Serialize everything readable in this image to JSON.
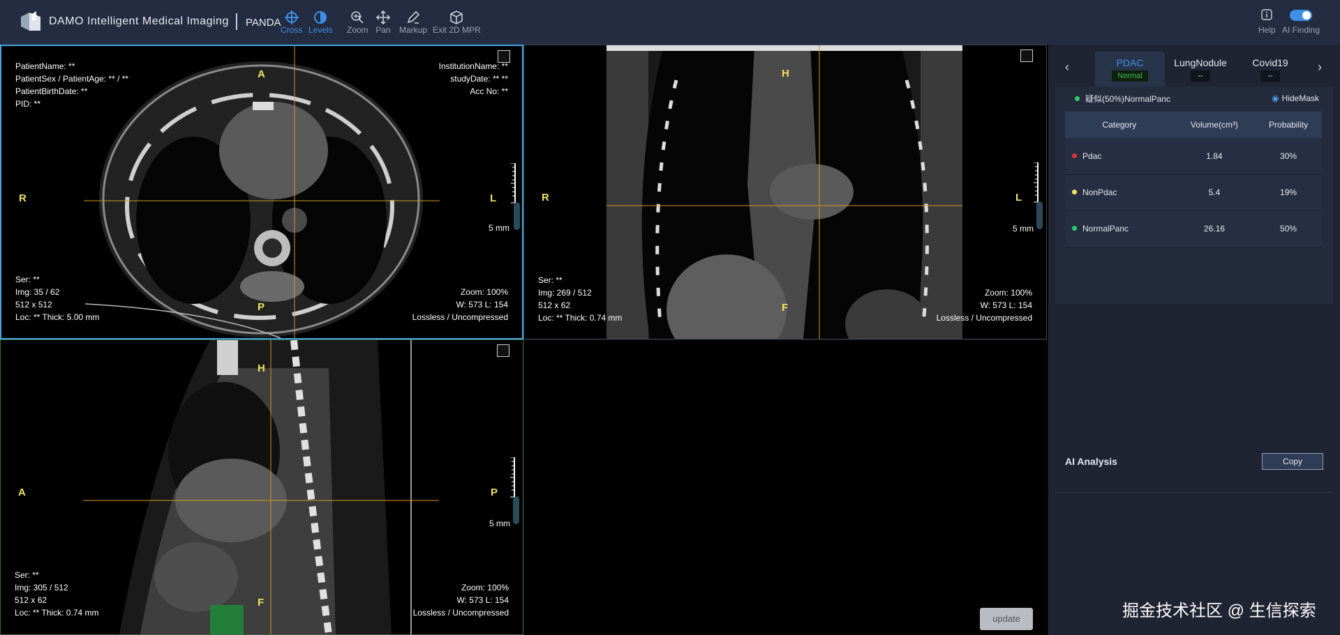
{
  "brand": {
    "name": "DAMO Intelligent Medical Imaging",
    "separator": "|",
    "sub": "PANDA"
  },
  "toolbar": [
    {
      "label": "Cross",
      "icon": "crosshair-icon",
      "active": true
    },
    {
      "label": "Levels",
      "icon": "levels-icon",
      "active": true
    },
    {
      "label": "Zoom",
      "icon": "zoom-icon",
      "active": false
    },
    {
      "label": "Pan",
      "icon": "pan-icon",
      "active": false
    },
    {
      "label": "Markup",
      "icon": "markup-icon",
      "active": false
    },
    {
      "label": "Exit 2D MPR",
      "icon": "cube-icon",
      "active": false
    }
  ],
  "toolbar_right": {
    "help": "Help",
    "ai_finding": "AI Finding"
  },
  "viewports": {
    "axial": {
      "patient": [
        "PatientName: **",
        "PatientSex / PatientAge: ** / **",
        "PatientBirthDate: **",
        "PID: **"
      ],
      "institution": [
        "InstitutionName: **",
        "studyDate: ** **",
        "Acc No: **"
      ],
      "series": [
        "Ser: **",
        "Img: 35 / 62",
        "512 x 512",
        "Loc: ** Thick: 5.00 mm"
      ],
      "display": [
        "Zoom: 100%",
        "W: 573 L: 154",
        "Lossless / Uncompressed"
      ],
      "orient": {
        "top": "A",
        "bottom": "P",
        "left": "R",
        "right": "L"
      },
      "scale": "5 mm"
    },
    "coronal": {
      "series": [
        "Ser: **",
        "Img: 269 / 512",
        "512 x 62",
        "Loc: ** Thick: 0.74 mm"
      ],
      "display": [
        "Zoom: 100%",
        "W: 573 L: 154",
        "Lossless / Uncompressed"
      ],
      "orient": {
        "top": "H",
        "bottom": "F",
        "left": "R",
        "right": "L"
      },
      "scale": "5 mm"
    },
    "sagittal": {
      "series": [
        "Ser: **",
        "Img: 305 / 512",
        "512 x 62",
        "Loc: ** Thick: 0.74 mm"
      ],
      "display": [
        "Zoom: 100%",
        "W: 573 L: 154",
        "Lossless / Uncompressed"
      ],
      "orient": {
        "top": "H",
        "bottom": "F",
        "left": "A",
        "right": "P"
      },
      "scale": "5 mm"
    }
  },
  "update_label": "update",
  "panel": {
    "tabs": [
      {
        "name": "PDAC",
        "status": "Normal",
        "active": true
      },
      {
        "name": "LungNodule",
        "status": "--",
        "active": false
      },
      {
        "name": "Covid19",
        "status": "--",
        "active": false
      }
    ],
    "finding": {
      "label": "疑似(50%)NormalPanc",
      "dot_color": "#2ecc71"
    },
    "hide_mask": "HideMask",
    "table": {
      "headers": [
        "Category",
        "Volume(cm³)",
        "Probability"
      ],
      "rows": [
        {
          "category": "Pdac",
          "volume": "1.84",
          "probability": "30%",
          "color": "#e0303a"
        },
        {
          "category": "NonPdac",
          "volume": "5.4",
          "probability": "19%",
          "color": "#f2e35e"
        },
        {
          "category": "NormalPanc",
          "volume": "26.16",
          "probability": "50%",
          "color": "#2ecc71"
        }
      ]
    },
    "ai_analysis": "AI Analysis",
    "copy": "Copy"
  },
  "watermark": "掘金技术社区 @ 生信探索",
  "colors": {
    "accent": "#3f8fe6",
    "crosshair": "#d29a22",
    "orient": "#f2e35e",
    "frame_active": "#41a6e0"
  }
}
